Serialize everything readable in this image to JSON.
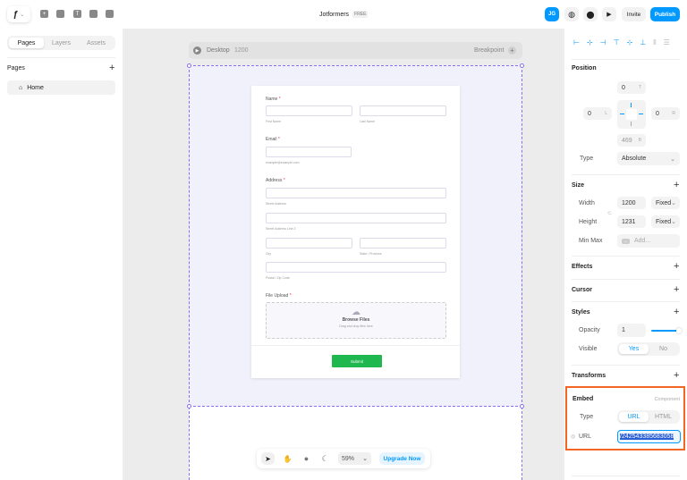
{
  "topbar": {
    "project": "Jotformers",
    "plan_badge": "FREE",
    "avatar": "JG",
    "invite": "Invite",
    "publish": "Publish"
  },
  "left": {
    "tabs": [
      "Pages",
      "Layers",
      "Assets"
    ],
    "pages_heading": "Pages",
    "pages": [
      {
        "label": "Home"
      }
    ]
  },
  "canvas": {
    "breakpoint_name": "Desktop",
    "breakpoint_width": "1200",
    "breakpoint_label": "Breakpoint",
    "form": {
      "name_label": "Name",
      "first": "First Name",
      "last": "Last Name",
      "email_label": "Email",
      "email_hint": "example@example.com",
      "address_label": "Address",
      "street1": "Street Address",
      "street2": "Street Address Line 2",
      "city": "City",
      "state": "State / Province",
      "zip": "Postal / Zip Code",
      "upload_label": "File Upload",
      "browse": "Browse Files",
      "drag": "Drag and drop files here",
      "submit": "Submit"
    }
  },
  "toolbar": {
    "zoom": "59%",
    "upgrade": "Upgrade Now"
  },
  "right": {
    "position": {
      "title": "Position",
      "top": "0",
      "left": "0",
      "right": "0",
      "bottom": "469",
      "t": "T",
      "l": "L",
      "r": "R",
      "b": "B",
      "type_label": "Type",
      "type": "Absolute"
    },
    "size": {
      "title": "Size",
      "width_label": "Width",
      "width": "1200",
      "width_mode": "Fixed",
      "height_label": "Height",
      "height": "1231",
      "height_mode": "Fixed",
      "minmax_label": "Min Max",
      "minmax_placeholder": "Add..."
    },
    "effects": "Effects",
    "cursor": "Cursor",
    "styles": {
      "title": "Styles",
      "opacity_label": "Opacity",
      "opacity": "1",
      "opacity_value": 1,
      "visible_label": "Visible",
      "yes": "Yes",
      "no": "No"
    },
    "transforms": "Transforms",
    "embed": {
      "title": "Embed",
      "tag": "Component",
      "type_label": "Type",
      "url_opt": "URL",
      "html_opt": "HTML",
      "url_label": "URL",
      "url_value": "/242543385683058"
    }
  },
  "colors": {
    "accent": "#0099ff",
    "highlight": "#f26522",
    "submit": "#1eb84f",
    "frame": "#8a70f0"
  }
}
